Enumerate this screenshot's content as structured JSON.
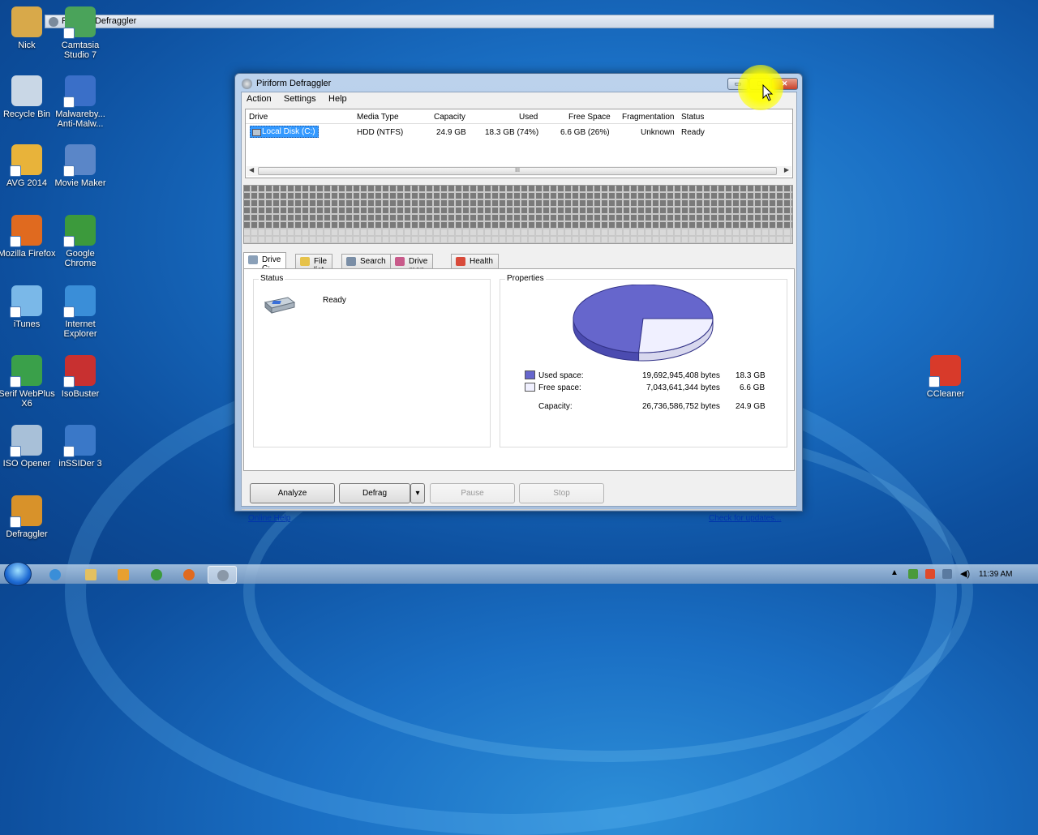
{
  "taskstrip": {
    "title": "Piriform Defraggler"
  },
  "desktop_icons": [
    {
      "label": "Nick",
      "color": "#d8a94a"
    },
    {
      "label": "Camtasia Studio 7",
      "color": "#4aa35a"
    },
    {
      "label": "Recycle Bin",
      "color": "#c9d7e6"
    },
    {
      "label": "Malwareby... Anti-Malw...",
      "color": "#3a6fc8"
    },
    {
      "label": "AVG 2014",
      "color": "#e8b33a"
    },
    {
      "label": "Movie Maker",
      "color": "#5a86c8"
    },
    {
      "label": "Mozilla Firefox",
      "color": "#e06a1f"
    },
    {
      "label": "Google Chrome",
      "color": "#3c9a3c"
    },
    {
      "label": "iTunes",
      "color": "#7ab8e8"
    },
    {
      "label": "Internet Explorer",
      "color": "#3a8ed8"
    },
    {
      "label": "Serif WebPlus X6",
      "color": "#3aa04a"
    },
    {
      "label": "IsoBuster",
      "color": "#c83030"
    },
    {
      "label": "ISO Opener",
      "color": "#a8c0d8"
    },
    {
      "label": "inSSIDer 3",
      "color": "#3a78c8"
    },
    {
      "label": "Defraggler",
      "color": "#d8922a"
    },
    {
      "label": "CCleaner",
      "color": "#d83a2a"
    }
  ],
  "window": {
    "title": "Piriform Defraggler",
    "controls": {
      "min": "▭",
      "max": "□",
      "close": "✕"
    }
  },
  "menu": [
    "Action",
    "Settings",
    "Help"
  ],
  "drive_table": {
    "headers": [
      "Drive",
      "Media Type",
      "Capacity",
      "Used",
      "Free Space",
      "Fragmentation",
      "Status"
    ],
    "rows": [
      {
        "drive": "Local Disk (C:)",
        "media": "HDD (NTFS)",
        "capacity": "24.9 GB",
        "used": "18.3 GB (74%)",
        "free": "6.6 GB (26%)",
        "fragmentation": "Unknown",
        "status": "Ready"
      }
    ],
    "scroll_grip": "III"
  },
  "tabs": [
    {
      "label": "Drive C:",
      "icon": "drive-icon",
      "color": "#8aa0b8"
    },
    {
      "label": "File list",
      "icon": "folder-icon",
      "color": "#e6c24a"
    },
    {
      "label": "Search",
      "icon": "search-icon",
      "color": "#7a8ea6"
    },
    {
      "label": "Drive map",
      "icon": "drive-map-icon",
      "color": "#c85a8a"
    },
    {
      "label": "Health",
      "icon": "health-icon",
      "color": "#d84a3a"
    }
  ],
  "status_group": {
    "title": "Status",
    "value": "Ready"
  },
  "properties_group": {
    "title": "Properties",
    "used_color": "#6666cc",
    "free_color": "#f0f0ff",
    "used_fraction": 0.74,
    "rows": [
      {
        "label": "Used space:",
        "bytes": "19,692,945,408",
        "unit": "bytes",
        "gb": "18.3 GB"
      },
      {
        "label": "Free space:",
        "bytes": "7,043,641,344",
        "unit": "bytes",
        "gb": "6.6 GB"
      },
      {
        "label": "Capacity:",
        "bytes": "26,736,586,752",
        "unit": "bytes",
        "gb": "24.9 GB"
      }
    ]
  },
  "buttons": {
    "analyze": "Analyze",
    "defrag": "Defrag",
    "pause": "Pause",
    "stop": "Stop"
  },
  "links": {
    "online_help": "Online Help",
    "check_updates": "Check for updates..."
  },
  "taskbar": {
    "clock": "11:39 AM",
    "tray_arrow": "▲"
  }
}
